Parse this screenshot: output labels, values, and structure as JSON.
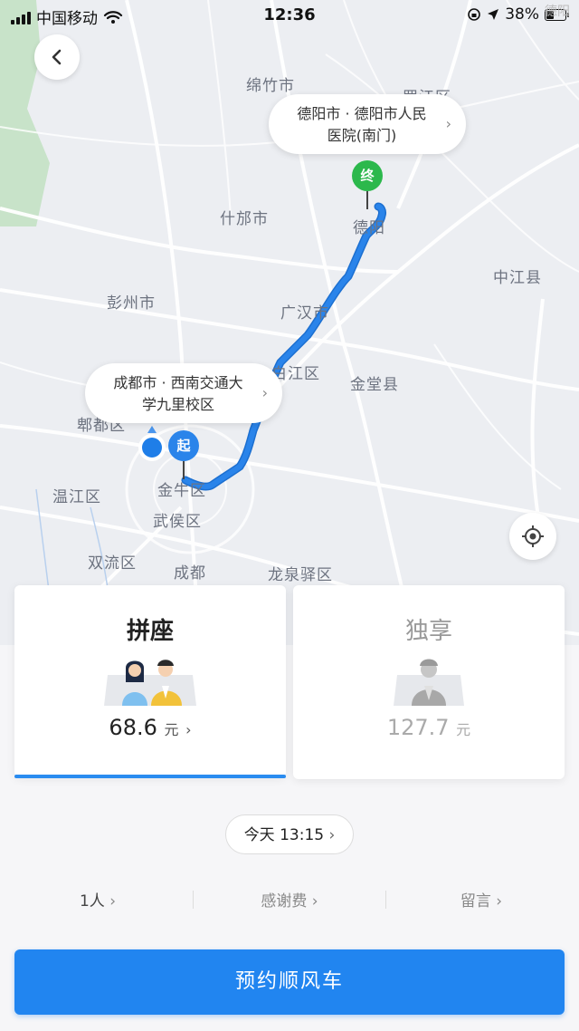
{
  "status_bar": {
    "carrier": "中国移动",
    "time": "12:36",
    "battery": "38%"
  },
  "watermark": "德阳",
  "map": {
    "cities": [
      "绵竹市",
      "罗江区",
      "什邡市",
      "德阳",
      "中江县",
      "彭州市",
      "广汉市",
      "白江区",
      "金堂县",
      "郫都区",
      "温江区",
      "金牛区",
      "武侯区",
      "双流区",
      "成都",
      "龙泉驿区"
    ],
    "destination_bubble": {
      "line1": "德阳市 · 德阳市人民",
      "line2": "医院(南门)"
    },
    "origin_bubble": {
      "line1": "成都市 · 西南交通大",
      "line2": "学九里校区"
    },
    "start_marker": "起",
    "end_marker": "终",
    "route_color": "#2a84ea"
  },
  "options": [
    {
      "title": "拼座",
      "price": "68.6",
      "unit": "元",
      "selected": true
    },
    {
      "title": "独享",
      "price": "127.7",
      "unit": "元",
      "selected": false
    }
  ],
  "departure_time": "今天 13:15",
  "extras": {
    "people": "1人",
    "tip": "感谢费",
    "message": "留言"
  },
  "cta": "预约顺风车",
  "colors": {
    "accent": "#2185f0",
    "start": "#2a84ea",
    "end": "#2cb84c"
  }
}
